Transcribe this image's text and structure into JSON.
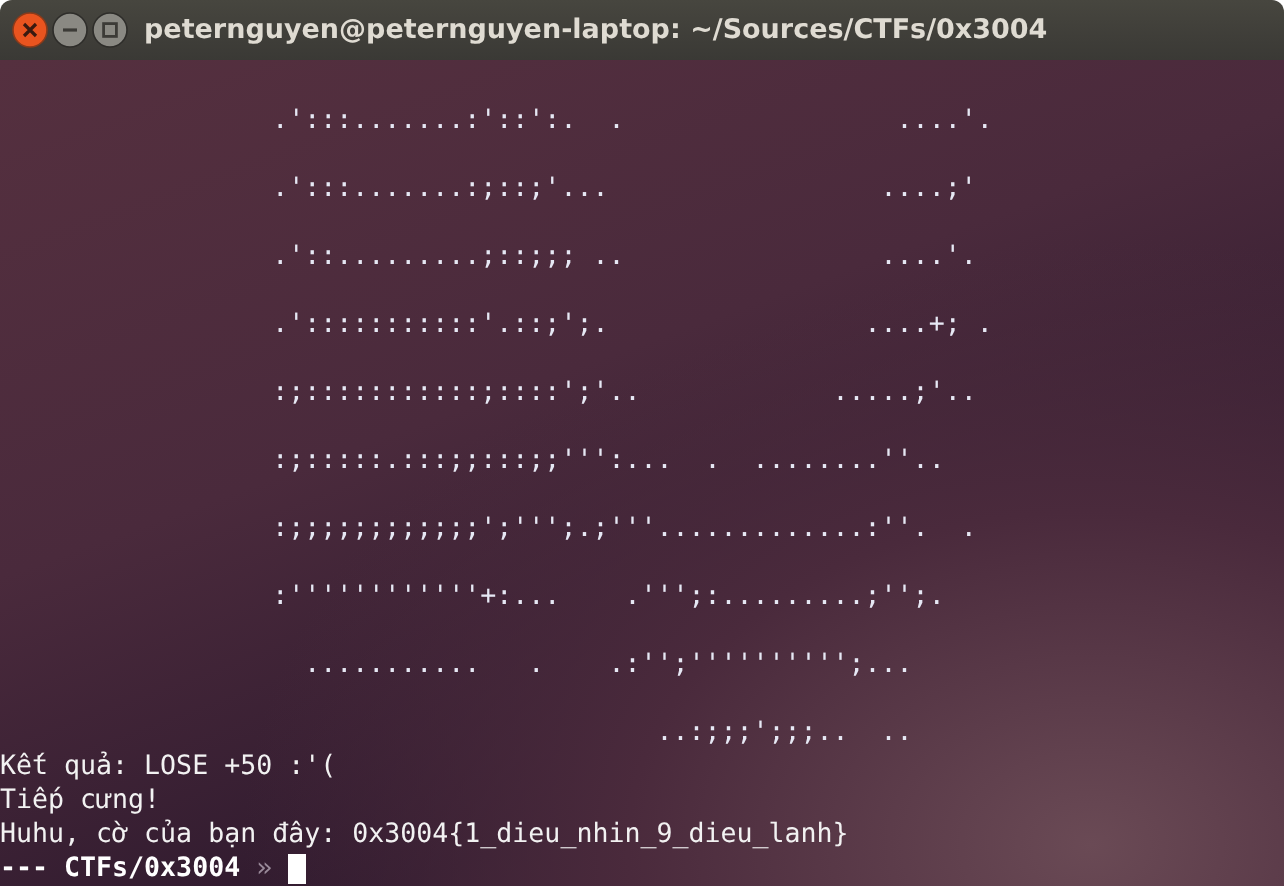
{
  "window": {
    "title": "peternguyen@peternguyen-laptop: ~/Sources/CTFs/0x3004"
  },
  "art_lines": [
    "                 .':::.......:'::':.  .                 ....'.",
    "                 .':::.......:;::;'...                 ....;'",
    "                 .'::.........;::;;; ..                ....'.",
    "                 .':::::::::::'.::;';.                ....+; .",
    "                 :;:::::::::::;::::';'..            .....;'..",
    "                 :;:::::.:::;;:::;;''':...  .  ........''..",
    "                 :;;;;;;;;;;;;';''';.;'''.............:''.  .",
    "                 :''''''''''''+:...    .''';:.........;'';.",
    "                   ...........   .    .:'';'''''''''';...",
    "                                         ..:;;;';;;..  .."
  ],
  "output_lines": [
    "Kết quả: LOSE +50 :'(",
    "Tiếp cưng!",
    "Huhu, cờ của bạn đây: 0x3004{1_dieu_nhin_9_dieu_lanh}"
  ],
  "prompt": {
    "path": "--- CTFs/0x3004",
    "symbol": "»"
  }
}
